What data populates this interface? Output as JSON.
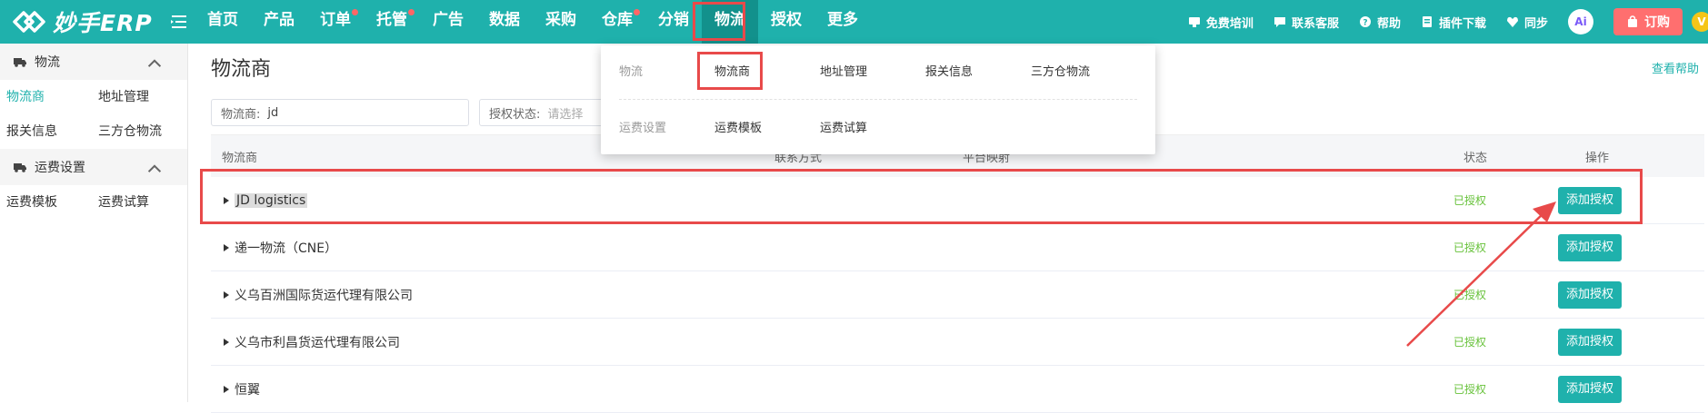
{
  "brand": {
    "name": "妙手ERP"
  },
  "colors": {
    "primary": "#1fb1ac",
    "highlight": "#e84a4a",
    "success": "#67c23a",
    "order": "#ff6f6f"
  },
  "nav": {
    "items": [
      {
        "label": "首页",
        "dot": false
      },
      {
        "label": "产品",
        "dot": false
      },
      {
        "label": "订单",
        "dot": true
      },
      {
        "label": "托管",
        "dot": true
      },
      {
        "label": "广告",
        "dot": false
      },
      {
        "label": "数据",
        "dot": false
      },
      {
        "label": "采购",
        "dot": false
      },
      {
        "label": "仓库",
        "dot": true
      },
      {
        "label": "分销",
        "dot": false
      },
      {
        "label": "物流",
        "dot": false,
        "active": true
      },
      {
        "label": "授权",
        "dot": false
      },
      {
        "label": "更多",
        "dot": false
      }
    ]
  },
  "tools": {
    "training": "免费培训",
    "support": "联系客服",
    "help": "帮助",
    "plugin": "插件下载",
    "sync": "同步",
    "ai": "Ai",
    "order": "订购",
    "vip": "V"
  },
  "sidebar": {
    "groups": [
      {
        "title": "物流",
        "icon": "truck-icon",
        "items": [
          "物流商",
          "地址管理",
          "报关信息",
          "三方仓物流"
        ]
      },
      {
        "title": "运费设置",
        "icon": "truck-icon",
        "items": [
          "运费模板",
          "运费试算"
        ]
      }
    ]
  },
  "page": {
    "title": "物流商",
    "help_link": "查看帮助"
  },
  "filters": {
    "carrier_label": "物流商:",
    "carrier_value": "jd",
    "auth_label": "授权状态:",
    "auth_placeholder": "请选择"
  },
  "table": {
    "headers": {
      "carrier": "物流商",
      "contact": "联系方式",
      "platform": "平台映射",
      "status": "状态",
      "actions": "操作"
    },
    "rows": [
      {
        "name": "JD logistics",
        "status": "已授权",
        "action": "添加授权"
      },
      {
        "name": "递一物流（CNE）",
        "status": "已授权",
        "action": "添加授权"
      },
      {
        "name": "义乌百洲国际货运代理有限公司",
        "status": "已授权",
        "action": "添加授权"
      },
      {
        "name": "义乌市利昌货运代理有限公司",
        "status": "已授权",
        "action": "添加授权"
      },
      {
        "name": "恒翼",
        "status": "已授权",
        "action": "添加授权"
      }
    ]
  },
  "dropdown": {
    "logistics_label": "物流",
    "logistics_links": [
      "物流商",
      "地址管理",
      "报关信息",
      "三方仓物流"
    ],
    "freight_label": "运费设置",
    "freight_links": [
      "运费模板",
      "运费试算"
    ]
  }
}
